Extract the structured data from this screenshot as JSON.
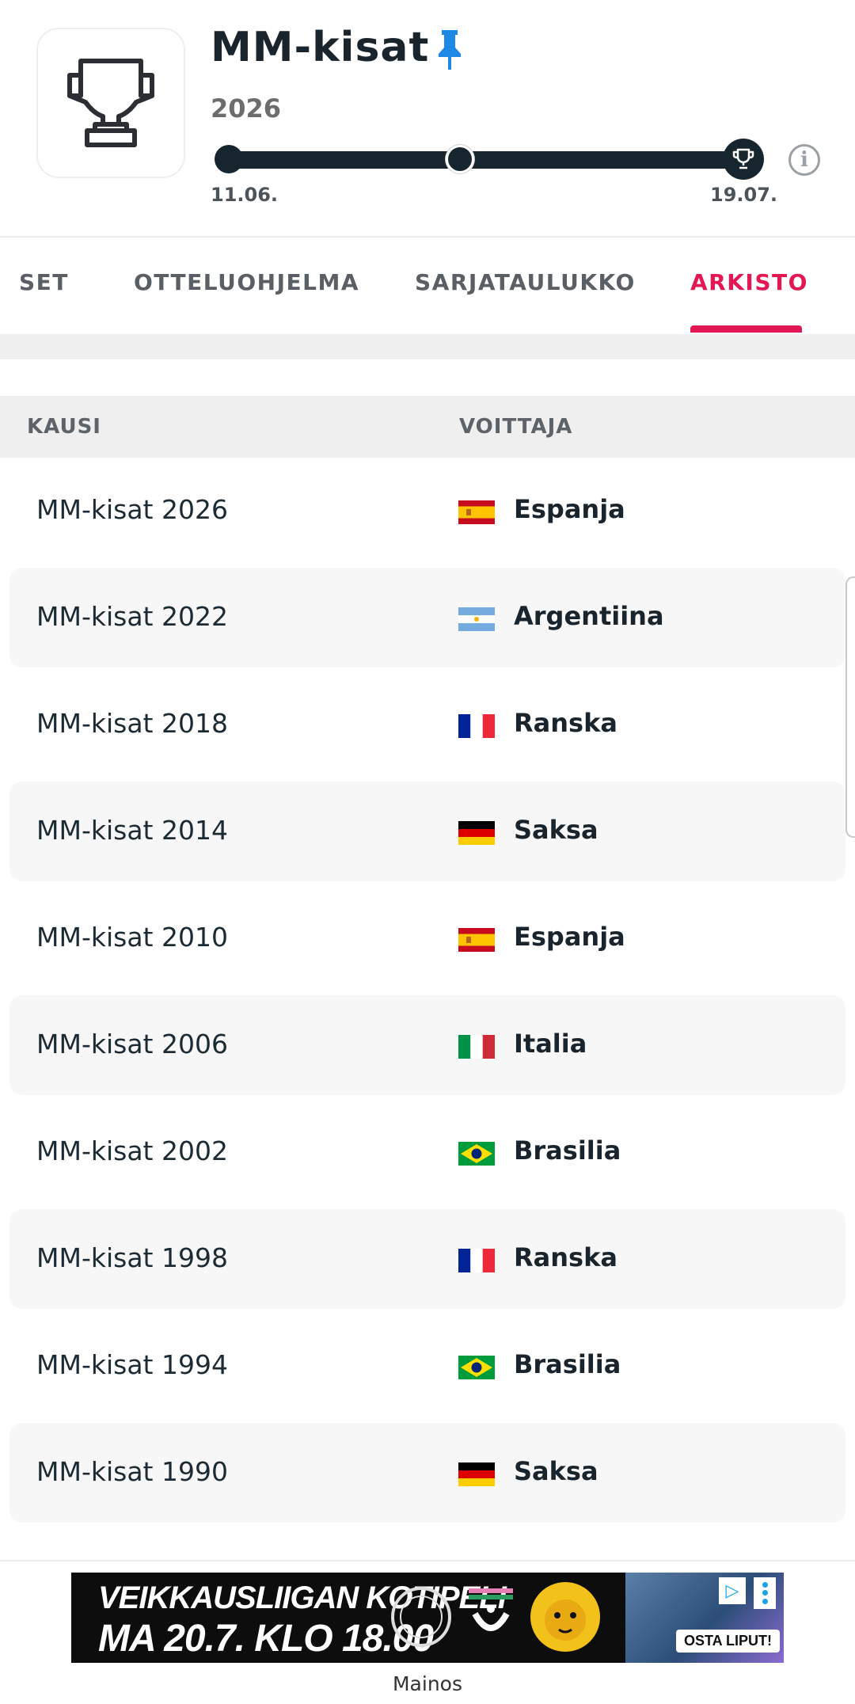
{
  "header": {
    "title": "MM-kisat",
    "season": "2026",
    "date_start": "11.06.",
    "date_end": "19.07.",
    "progress": 1.0
  },
  "tabs": [
    {
      "label": "SET",
      "active": false
    },
    {
      "label": "OTTELUOHJELMA",
      "active": false
    },
    {
      "label": "SARJATAULUKKO",
      "active": false
    },
    {
      "label": "ARKISTO",
      "active": true
    }
  ],
  "table": {
    "headers": {
      "season": "KAUSI",
      "winner": "VOITTAJA"
    },
    "rows": [
      {
        "season": "MM-kisat 2026",
        "winner": "Espanja",
        "flag": "spain"
      },
      {
        "season": "MM-kisat 2022",
        "winner": "Argentiina",
        "flag": "argentina"
      },
      {
        "season": "MM-kisat 2018",
        "winner": "Ranska",
        "flag": "france"
      },
      {
        "season": "MM-kisat 2014",
        "winner": "Saksa",
        "flag": "germany"
      },
      {
        "season": "MM-kisat 2010",
        "winner": "Espanja",
        "flag": "spain"
      },
      {
        "season": "MM-kisat 2006",
        "winner": "Italia",
        "flag": "italy"
      },
      {
        "season": "MM-kisat 2002",
        "winner": "Brasilia",
        "flag": "brazil"
      },
      {
        "season": "MM-kisat 1998",
        "winner": "Ranska",
        "flag": "france"
      },
      {
        "season": "MM-kisat 1994",
        "winner": "Brasilia",
        "flag": "brazil"
      },
      {
        "season": "MM-kisat 1990",
        "winner": "Saksa",
        "flag": "germany"
      }
    ]
  },
  "ad": {
    "line1": "VEIKKAUSLIIGAN KOTIPELI",
    "line2": "MA 20.7. KLO 18.00",
    "cta": "OSTA LIPUT!",
    "label": "Mainos"
  },
  "colors": {
    "accent": "#e21753",
    "dark": "#17262e",
    "pin": "#1e88e5"
  }
}
